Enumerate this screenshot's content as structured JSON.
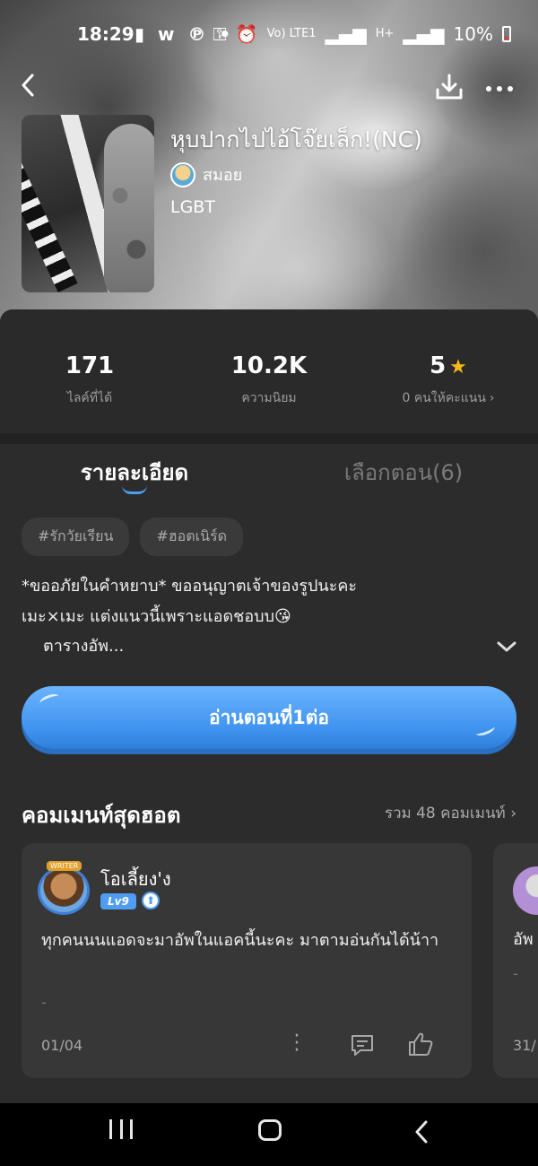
{
  "status_bar": {
    "time": "18:29",
    "left_icons": "▮ w ℗ •",
    "signal_label_1": "Vo) LTE1",
    "signal_label_2": "H+",
    "battery": "10%"
  },
  "header": {
    "back_icon": "back-icon",
    "download_icon": "download-icon",
    "more_icon": "more-icon"
  },
  "story": {
    "title": "หุบปากไปไอ้โจ๊ยเล็ก!(NC)",
    "author": "สมอย",
    "category": "LGBT"
  },
  "stats": [
    {
      "value": "171",
      "label": "ไลค์ที่ได้"
    },
    {
      "value": "10.2K",
      "label": "ความนิยม"
    },
    {
      "value": "5",
      "label": "0 คนให้คะแนน"
    }
  ],
  "tabs": {
    "details": "รายละเอียด",
    "episodes": "เลือกตอน(6)"
  },
  "tags": [
    "#รักวัยเรียน",
    "#ฮอตเนิร์ด"
  ],
  "description": {
    "line1": "*ขออภัยในคำหยาบ* ขออนุญาตเจ้าของรูปนะคะ",
    "line2": "เมะ×เมะ แต่งแนวนี้เพราะแอดชอบบ😘",
    "more": "ตารางอัพ..."
  },
  "read_button": "อ่านตอนที่1ต่อ",
  "hot_comments": {
    "heading": "คอมเมนท์สุดฮอต",
    "total": "รวม 48 คอมเมนท์",
    "items": [
      {
        "badge": "WRITER",
        "name": "โอเลี้ยง'ง",
        "level": "Lv9",
        "text": "ทุกคนนนแอดจะมาอัพในแอคนี้นะคะ มาตามอ่นกันได้น้าา",
        "dash": "-",
        "date": "01/04"
      },
      {
        "text": "อัพ",
        "dash": "-",
        "date": "31/"
      }
    ]
  },
  "colors": {
    "accent": "#4aa0f0",
    "star": "#f6b81a",
    "panel": "#2c2c2d"
  }
}
